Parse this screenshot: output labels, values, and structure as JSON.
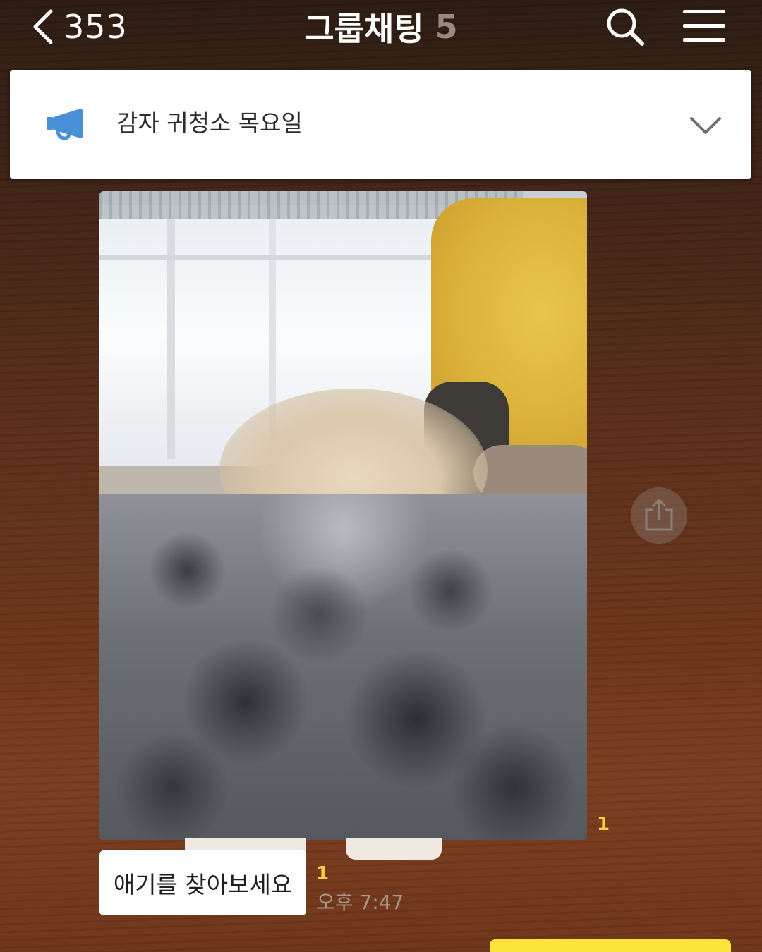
{
  "header": {
    "back_count": "353",
    "title": "그룹채팅",
    "member_count": "5"
  },
  "icons": {
    "back": "chevron-left-icon",
    "search": "search-icon",
    "menu": "hamburger-menu-icon",
    "notice": "megaphone-icon",
    "notice_toggle": "chevron-down-icon",
    "share": "share-icon"
  },
  "notice": {
    "text": "감자 귀청소 목요일"
  },
  "messages": [
    {
      "type": "photo",
      "unread_count": "1"
    },
    {
      "type": "text",
      "text": "애기를 찾아보세요",
      "unread_count": "1",
      "time": "오후 7:47"
    }
  ],
  "colors": {
    "unread": "#f5d03b",
    "my_bubble": "#fbe53b",
    "notice_icon": "#4a90d9"
  }
}
